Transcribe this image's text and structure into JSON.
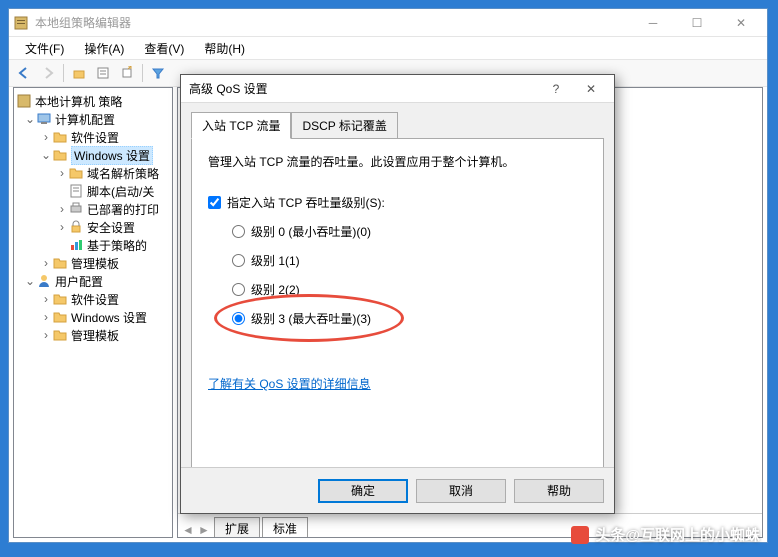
{
  "window": {
    "title": "本地组策略编辑器"
  },
  "menu": {
    "file": "文件(F)",
    "action": "操作(A)",
    "view": "查看(V)",
    "help": "帮助(H)"
  },
  "tree": {
    "root": "本地计算机 策略",
    "computer_config": "计算机配置",
    "software_settings": "软件设置",
    "windows_settings": "Windows 设置",
    "dns_policy": "域名解析策略",
    "scripts": "脚本(启动/关",
    "deployed_printers": "已部署的打印",
    "security_settings": "安全设置",
    "policy_based": "基于策略的",
    "admin_templates": "管理模板",
    "user_config": "用户配置",
    "software_settings2": "软件设置",
    "windows_settings2": "Windows 设置",
    "admin_templates2": "管理模板"
  },
  "tabs": {
    "extended": "扩展",
    "standard": "标准"
  },
  "dialog": {
    "title": "高级 QoS 设置",
    "tab1": "入站 TCP 流量",
    "tab2": "DSCP 标记覆盖",
    "description": "管理入站 TCP 流量的吞吐量。此设置应用于整个计算机。",
    "checkbox": "指定入站 TCP 吞吐量级别(S):",
    "level0": "级别 0 (最小吞吐量)(0)",
    "level1": "级别 1(1)",
    "level2": "级别 2(2)",
    "level3": "级别 3 (最大吞吐量)(3)",
    "link": "了解有关 QoS 设置的详细信息",
    "ok": "确定",
    "cancel": "取消",
    "help": "帮助"
  },
  "watermark": "头条@互联网上的小蜘蛛"
}
